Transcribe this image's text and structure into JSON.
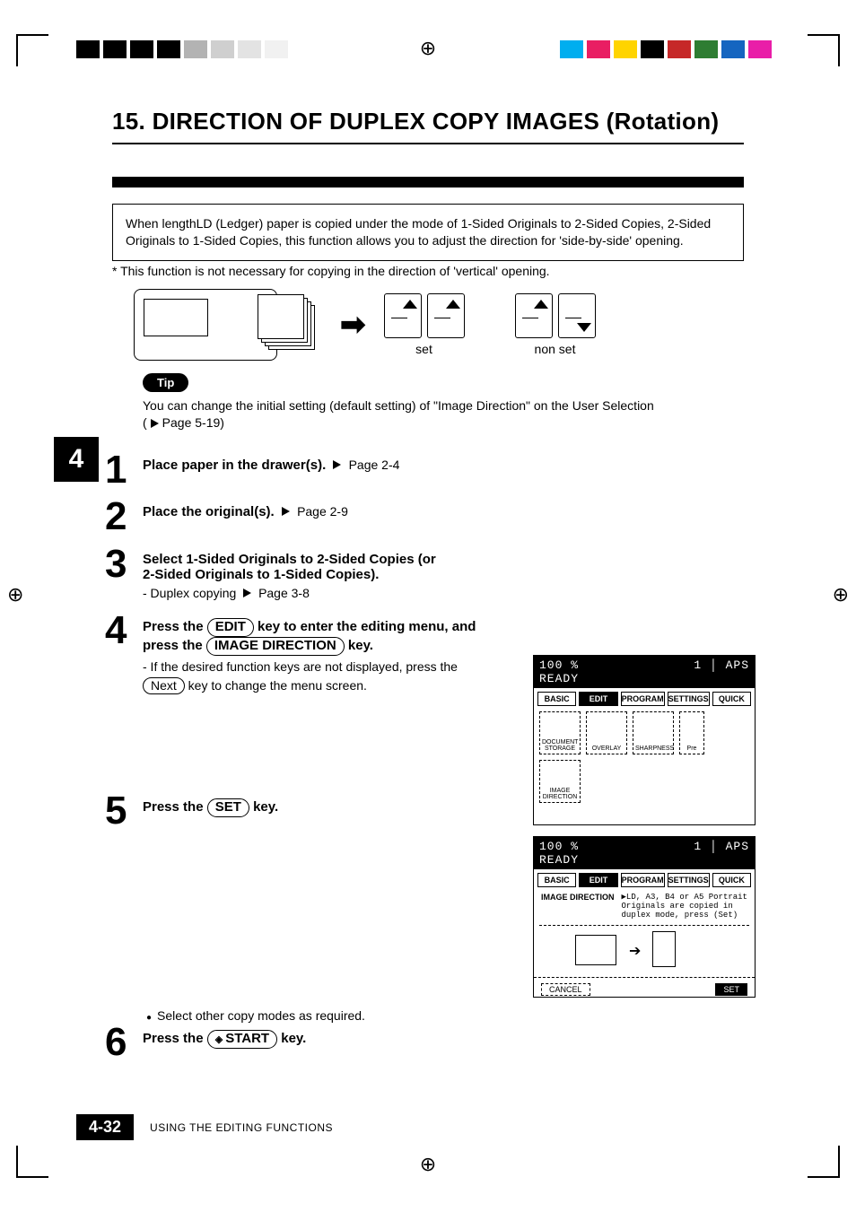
{
  "heading": "15. DIRECTION OF DUPLEX COPY IMAGES (Rotation)",
  "intro": "When lengthLD (Ledger) paper is copied under the mode of 1-Sided Originals to 2-Sided Copies, 2-Sided Originals to 1-Sided Copies, this function allows you to adjust the direction for 'side-by-side' opening.",
  "intro_note": "* This function is not necessary for copying in the direction of 'vertical' opening.",
  "diagram": {
    "set_label": "set",
    "nonset_label": "non set"
  },
  "tip": {
    "pill": "Tip",
    "text": "You can change the initial setting (default setting) of \"Image Direction\" on the User Selection",
    "xref": "Page 5-19"
  },
  "chapter_tab": "4",
  "steps": {
    "s1": {
      "num": "1",
      "hdr": "Place paper in the drawer(s).",
      "xref": "Page 2-4"
    },
    "s2": {
      "num": "2",
      "hdr": "Place the original(s).",
      "xref": "Page 2-9"
    },
    "s3": {
      "num": "3",
      "hdr_a": "Select 1-Sided Originals to 2-Sided Copies (or",
      "hdr_b": "2-Sided Originals to 1-Sided Copies).",
      "sub": "- Duplex copying",
      "sub_xref": "Page 3-8"
    },
    "s4": {
      "num": "4",
      "hdr_a": "Press the ",
      "key1": "EDIT",
      "hdr_b": " key to enter the editing menu, and",
      "hdr_c": "press the ",
      "key2": "IMAGE DIRECTION",
      "hdr_d": " key.",
      "sub": "- If the desired function keys are not displayed, press the",
      "sub2_key": "Next",
      "sub2_rest": " key to change the menu screen."
    },
    "s5": {
      "num": "5",
      "hdr_a": "Press the ",
      "key": "SET",
      "hdr_b": " key."
    },
    "s6": {
      "num": "6",
      "hdr_a": "Press the ",
      "key": "START",
      "hdr_b": " key."
    }
  },
  "screens": {
    "s1": {
      "top_a": "100  %",
      "top_b": "1",
      "aps": "APS",
      "ready": "READY",
      "tabs": [
        "BASIC",
        "EDIT",
        "PROGRAM",
        "SETTINGS",
        "QUICK"
      ],
      "icons": [
        "DOCUMENT STORAGE",
        "OVERLAY",
        "SHARPNESS",
        "Pre"
      ],
      "lasticon": "IMAGE DIRECTION"
    },
    "s2": {
      "top_a": "100  %",
      "top_b": "1",
      "aps": "APS",
      "ready": "READY",
      "tabs": [
        "BASIC",
        "EDIT",
        "PROGRAM",
        "SETTINGS",
        "QUICK"
      ],
      "lbl": "IMAGE DIRECTION",
      "msg": "▶LD, A3, B4 or A5 Portrait Originals are copied in duplex mode, press (Set)",
      "cancel": "CANCEL",
      "set": "SET"
    }
  },
  "bullet": "Select other copy modes as required.",
  "footer": {
    "page": "4-32",
    "text": "USING THE EDITING FUNCTIONS"
  }
}
